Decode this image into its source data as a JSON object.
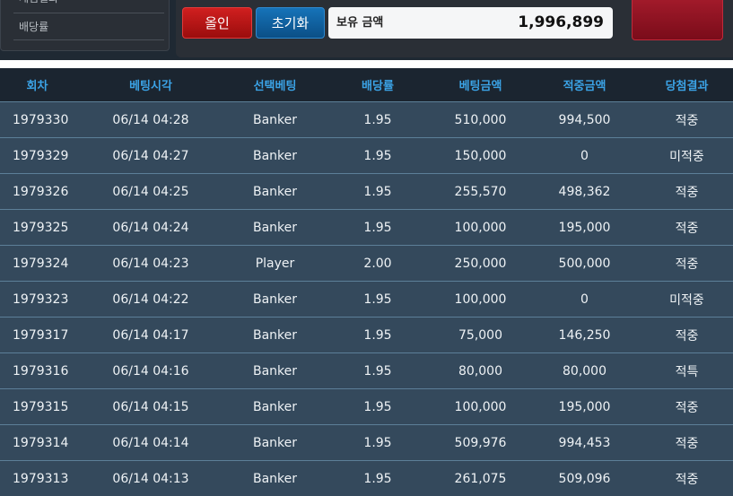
{
  "sidebar": {
    "items": [
      {
        "label": "게임결과"
      },
      {
        "label": "배당률"
      }
    ]
  },
  "controls": {
    "allin_label": "올인",
    "reset_label": "초기화",
    "balance_label": "보유 금액",
    "balance_value": "1,996,899"
  },
  "table": {
    "headers": [
      "회차",
      "베팅시각",
      "선택베팅",
      "배당률",
      "베팅금액",
      "적중금액",
      "당첨결과"
    ],
    "rows": [
      {
        "round": "1979330",
        "time": "06/14 04:28",
        "pick": "Banker",
        "odds": "1.95",
        "bet": "510,000",
        "win": "994,500",
        "result": "적중",
        "status": "hit"
      },
      {
        "round": "1979329",
        "time": "06/14 04:27",
        "pick": "Banker",
        "odds": "1.95",
        "bet": "150,000",
        "win": "0",
        "result": "미적중",
        "status": "miss"
      },
      {
        "round": "1979326",
        "time": "06/14 04:25",
        "pick": "Banker",
        "odds": "1.95",
        "bet": "255,570",
        "win": "498,362",
        "result": "적중",
        "status": "hit"
      },
      {
        "round": "1979325",
        "time": "06/14 04:24",
        "pick": "Banker",
        "odds": "1.95",
        "bet": "100,000",
        "win": "195,000",
        "result": "적중",
        "status": "hit"
      },
      {
        "round": "1979324",
        "time": "06/14 04:23",
        "pick": "Player",
        "odds": "2.00",
        "bet": "250,000",
        "win": "500,000",
        "result": "적중",
        "status": "hit"
      },
      {
        "round": "1979323",
        "time": "06/14 04:22",
        "pick": "Banker",
        "odds": "1.95",
        "bet": "100,000",
        "win": "0",
        "result": "미적중",
        "status": "miss"
      },
      {
        "round": "1979317",
        "time": "06/14 04:17",
        "pick": "Banker",
        "odds": "1.95",
        "bet": "75,000",
        "win": "146,250",
        "result": "적중",
        "status": "hit"
      },
      {
        "round": "1979316",
        "time": "06/14 04:16",
        "pick": "Banker",
        "odds": "1.95",
        "bet": "80,000",
        "win": "80,000",
        "result": "적특",
        "status": "hit"
      },
      {
        "round": "1979315",
        "time": "06/14 04:15",
        "pick": "Banker",
        "odds": "1.95",
        "bet": "100,000",
        "win": "195,000",
        "result": "적중",
        "status": "hit"
      },
      {
        "round": "1979314",
        "time": "06/14 04:14",
        "pick": "Banker",
        "odds": "1.95",
        "bet": "509,976",
        "win": "994,453",
        "result": "적중",
        "status": "hit"
      },
      {
        "round": "1979313",
        "time": "06/14 04:13",
        "pick": "Banker",
        "odds": "1.95",
        "bet": "261,075",
        "win": "509,096",
        "result": "적중",
        "status": "hit"
      }
    ]
  },
  "colors": {
    "accent_header": "#3ba3e6",
    "hit": "#f0a62a",
    "miss": "#e0182c",
    "allin_button": "#c41a1a",
    "reset_button": "#1467a8"
  }
}
